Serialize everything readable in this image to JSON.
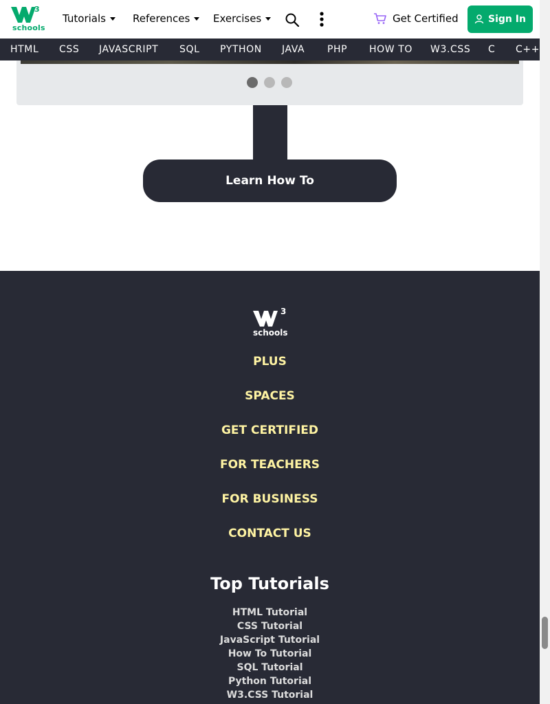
{
  "header": {
    "logo_text": "schools",
    "logo_superscript": "3",
    "menus": [
      {
        "label": "Tutorials"
      },
      {
        "label": "References"
      },
      {
        "label": "Exercises"
      }
    ],
    "get_certified": "Get Certified",
    "sign_in": "Sign In",
    "icons": [
      "search-icon",
      "more-vertical-icon",
      "cart-icon",
      "user-icon"
    ]
  },
  "subjects": [
    "HTML",
    "CSS",
    "JAVASCRIPT",
    "SQL",
    "PYTHON",
    "JAVA",
    "PHP",
    "HOW TO",
    "W3.CSS",
    "C",
    "C++"
  ],
  "carousel": {
    "active_index": 0,
    "dot_count": 3
  },
  "learn_button": "Learn How To",
  "footer": {
    "logo_text": "schools",
    "logo_superscript": "3",
    "links": [
      "PLUS",
      "SPACES",
      "GET CERTIFIED",
      "FOR TEACHERS",
      "FOR BUSINESS",
      "CONTACT US"
    ],
    "top_tutorials_title": "Top Tutorials",
    "tutorials": [
      "HTML Tutorial",
      "CSS Tutorial",
      "JavaScript Tutorial",
      "How To Tutorial",
      "SQL Tutorial",
      "Python Tutorial",
      "W3.CSS Tutorial"
    ]
  },
  "colors": {
    "brand_green": "#04AA6D",
    "dark": "#282A35",
    "footer_link": "#FFF4A3",
    "cart_purple": "#9763F6"
  }
}
